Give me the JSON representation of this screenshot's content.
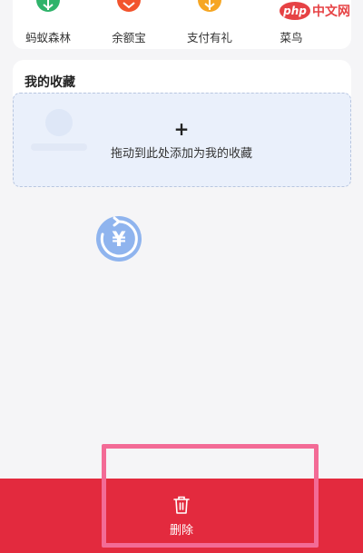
{
  "apps": [
    {
      "label": "蚂蚁森林",
      "icon": "ant-forest-icon",
      "color": "#2fb36b"
    },
    {
      "label": "余额宝",
      "icon": "yuebao-icon",
      "color": "#f2542d"
    },
    {
      "label": "支付有礼",
      "icon": "pay-gift-icon",
      "color": "#f6a623"
    },
    {
      "label": "菜鸟",
      "icon": "cainiao-icon",
      "color": "#2d7cf6"
    }
  ],
  "watermark": {
    "logo": "php",
    "text": "中文网"
  },
  "favorites": {
    "title": "我的收藏",
    "plus": "+",
    "hint": "拖动到此处添加为我的收藏"
  },
  "drag_icon": {
    "icon": "yen-refresh-icon",
    "glyph": "¥",
    "color": "#5b8fe6"
  },
  "delete_zone": {
    "label": "删除",
    "icon": "trash-icon",
    "color": "#e32a3e"
  },
  "highlight_color": "#f36b96"
}
